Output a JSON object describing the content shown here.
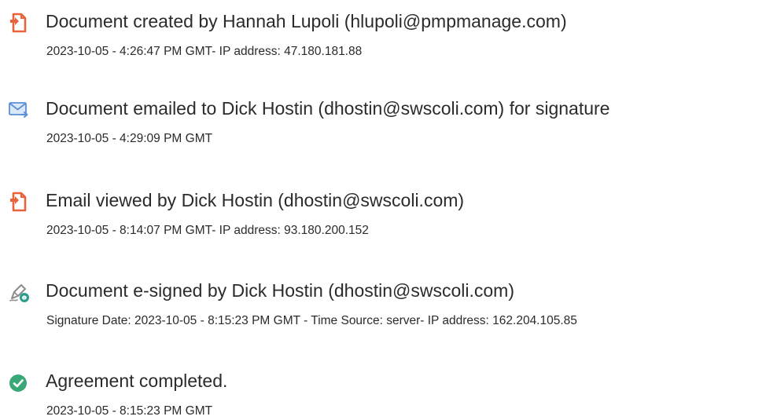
{
  "colors": {
    "doc_icon": "#e8623a",
    "email_icon": "#5a8fd6",
    "sign_icon": "#8c8c8c",
    "sign_badge": "#2a9d8f",
    "check_icon": "#3aa876",
    "text": "#2b2b2b"
  },
  "events": [
    {
      "icon": "document-icon",
      "title": "Document created by Hannah Lupoli (hlupoli@pmpmanage.com)",
      "detail": "2023-10-05 - 4:26:47 PM GMT- IP address: 47.180.181.88"
    },
    {
      "icon": "email-sent-icon",
      "title": "Document emailed to Dick Hostin (dhostin@swscoli.com) for signature",
      "detail": "2023-10-05 - 4:29:09 PM GMT"
    },
    {
      "icon": "document-icon",
      "title": "Email viewed by Dick Hostin (dhostin@swscoli.com)",
      "detail": "2023-10-05 - 8:14:07 PM GMT- IP address: 93.180.200.152"
    },
    {
      "icon": "pen-sign-icon",
      "title": "Document e-signed by Dick Hostin (dhostin@swscoli.com)",
      "detail": "Signature Date: 2023-10-05 - 8:15:23 PM GMT - Time Source: server- IP address: 162.204.105.85"
    },
    {
      "icon": "check-circle-icon",
      "title": "Agreement completed.",
      "detail": "2023-10-05 - 8:15:23 PM GMT"
    }
  ]
}
